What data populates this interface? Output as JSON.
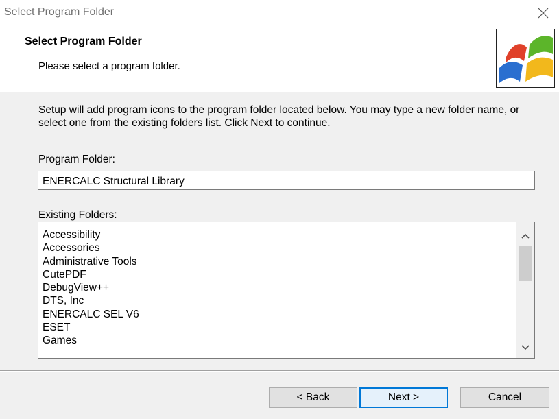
{
  "window": {
    "title": "Select Program Folder"
  },
  "header": {
    "title": "Select Program Folder",
    "subtitle": "Please select a program folder."
  },
  "main": {
    "description": "Setup will add program icons to the program folder located below. You may type a new folder name, or select one from the existing folders list. Click Next to continue.",
    "program_folder_label": "Program Folder:",
    "program_folder_value": "ENERCALC Structural Library",
    "existing_folders_label": "Existing Folders:",
    "existing_folders": [
      "Accessibility",
      "Accessories",
      "Administrative Tools",
      "CutePDF",
      "DebugView++",
      "DTS, Inc",
      "ENERCALC SEL V6",
      "ESET",
      "Games"
    ]
  },
  "buttons": {
    "back": "< Back",
    "next": "Next >",
    "cancel": "Cancel"
  },
  "icons": {
    "close": "close-icon",
    "logo": "windows-setup-logo",
    "scroll_up": "chevron-up-icon",
    "scroll_down": "chevron-down-icon"
  },
  "colors": {
    "focus_border": "#0078d7",
    "dialog_background": "#f0f0f0",
    "logo_red": "#e0412a",
    "logo_green": "#5cb52a",
    "logo_blue": "#2a6fd0",
    "logo_yellow": "#f2b81c"
  }
}
